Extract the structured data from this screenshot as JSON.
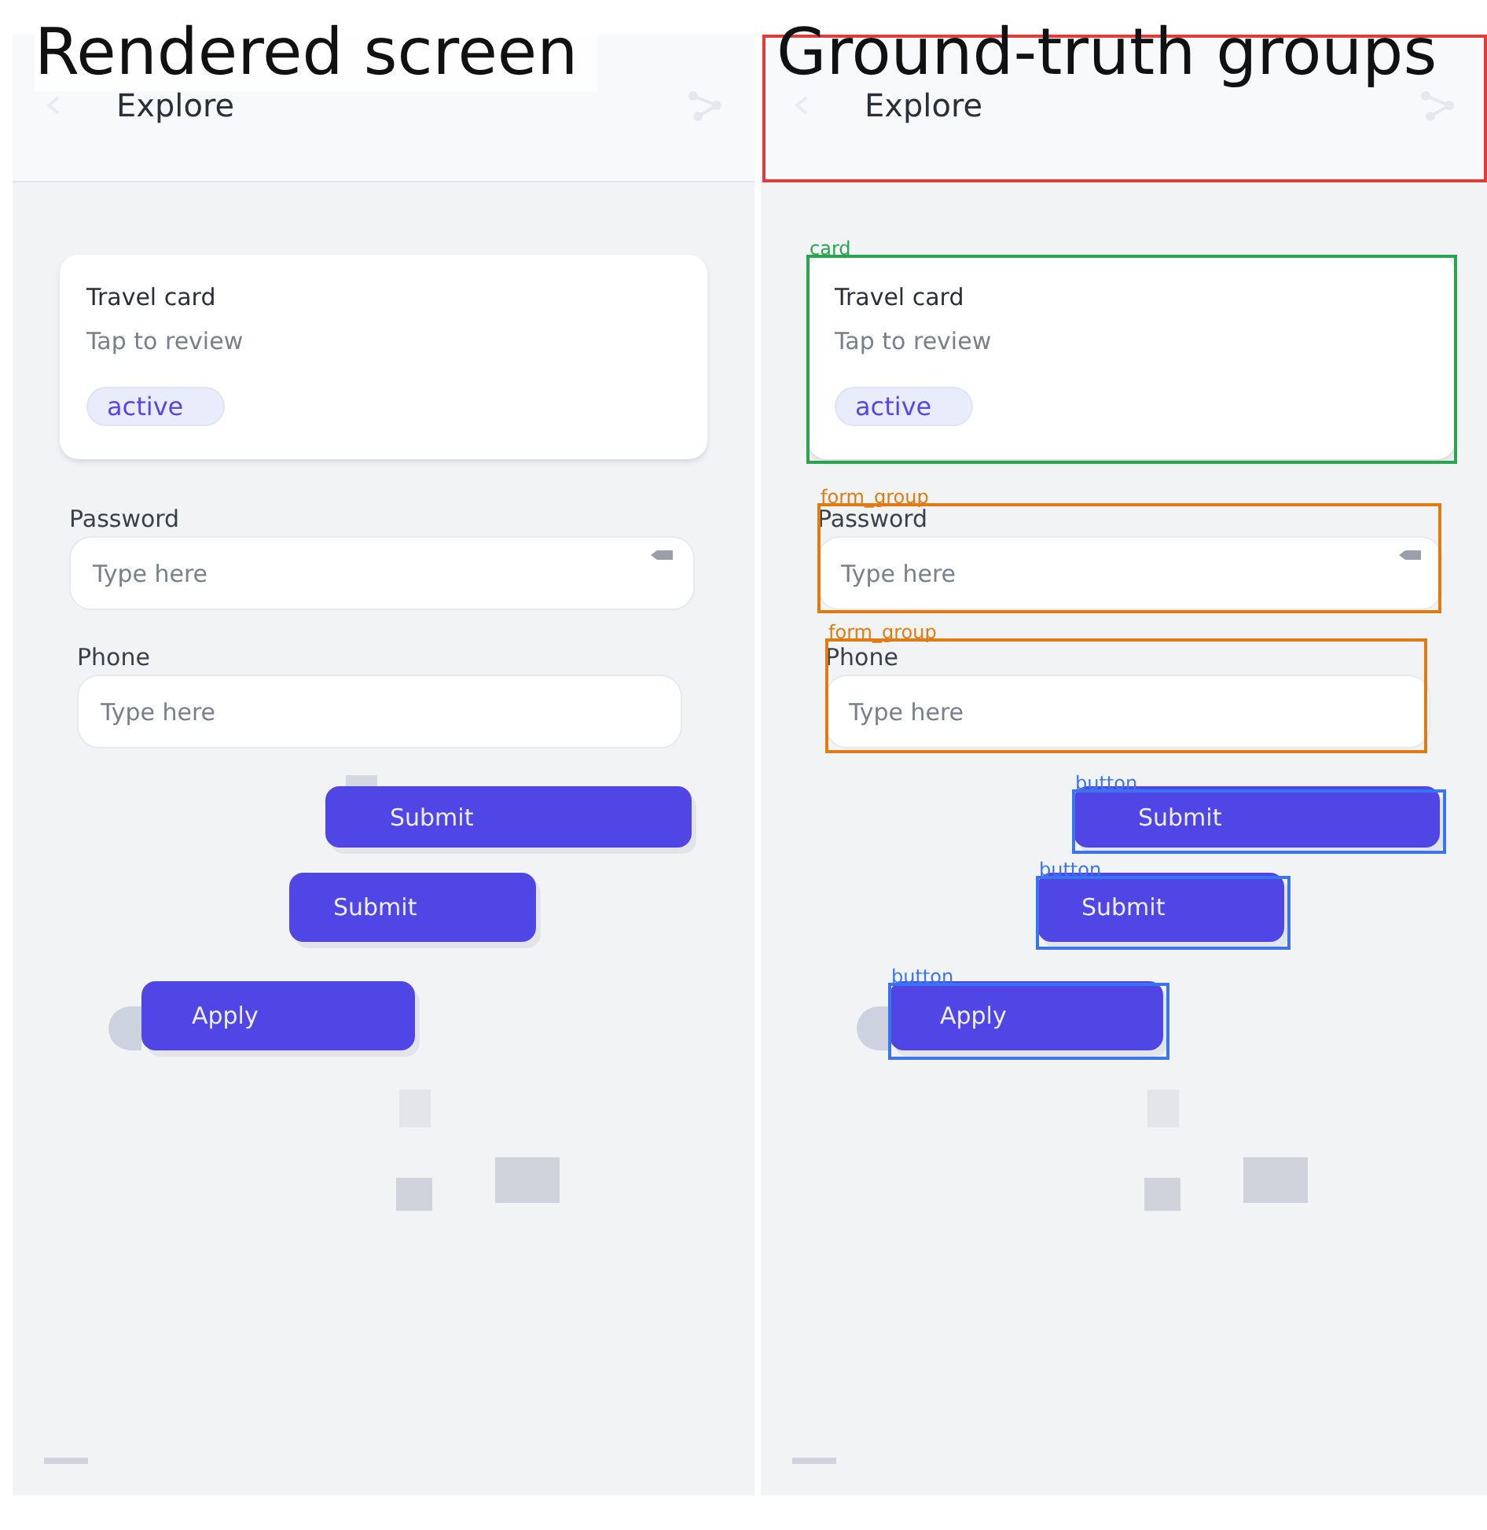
{
  "panels": [
    {
      "title": "Rendered screen",
      "screen": {
        "navbar": {
          "title": "Explore"
        },
        "card": {
          "title": "Travel card",
          "subtitle": "Tap to review",
          "tag": "active"
        },
        "fields": [
          {
            "label": "Password",
            "placeholder": "Type here",
            "kind": "password"
          },
          {
            "label": "Phone",
            "placeholder": "Type here",
            "kind": "text"
          }
        ],
        "buttons": [
          {
            "label": "Submit"
          },
          {
            "label": "Submit"
          },
          {
            "label": "Apply"
          }
        ]
      }
    },
    {
      "title": "Ground-truth groups",
      "screen": {
        "navbar": {
          "title": "Explore"
        },
        "card": {
          "title": "Travel card",
          "subtitle": "Tap to review",
          "tag": "active"
        },
        "fields": [
          {
            "label": "Password",
            "placeholder": "Type here",
            "kind": "password"
          },
          {
            "label": "Phone",
            "placeholder": "Type here",
            "kind": "text"
          }
        ],
        "buttons": [
          {
            "label": "Submit"
          },
          {
            "label": "Submit"
          },
          {
            "label": "Apply"
          }
        ]
      },
      "groups": [
        {
          "kind": "navbar"
        },
        {
          "kind": "card",
          "label": "card"
        },
        {
          "kind": "form_group",
          "label": "form_group"
        },
        {
          "kind": "form_group",
          "label": "form_group"
        },
        {
          "kind": "button",
          "label": "button"
        },
        {
          "kind": "button",
          "label": "button"
        },
        {
          "kind": "button",
          "label": "button"
        }
      ]
    }
  ]
}
